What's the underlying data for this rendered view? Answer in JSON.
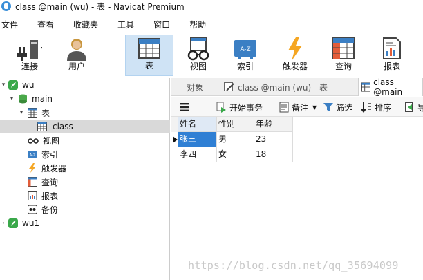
{
  "window": {
    "title": "class @main (wu) - 表 - Navicat Premium"
  },
  "menu": [
    "文件",
    "查看",
    "收藏夹",
    "工具",
    "窗口",
    "帮助"
  ],
  "toolbar": {
    "connect": "连接",
    "user": "用户",
    "table": "表",
    "view": "视图",
    "index": "索引",
    "trigger": "触发器",
    "query": "查询",
    "report": "报表"
  },
  "tree": {
    "conn1": "wu",
    "db": "main",
    "tables_group": "表",
    "table_class": "class",
    "views": "视图",
    "indexes": "索引",
    "triggers": "触发器",
    "queries": "查询",
    "reports": "报表",
    "backup": "备份",
    "conn2": "wu1"
  },
  "tabs": {
    "objects": "对象",
    "tab1": "class @main (wu) - 表",
    "tab2": "class @main"
  },
  "subtoolbar": {
    "begin_tx": "开始事务",
    "memo": "备注",
    "filter": "筛选",
    "sort": "排序",
    "import": "导"
  },
  "grid": {
    "columns": [
      "姓名",
      "性别",
      "年龄"
    ],
    "rows": [
      [
        "张三",
        "男",
        "23"
      ],
      [
        "李四",
        "女",
        "18"
      ]
    ]
  },
  "watermark": "https://blog.csdn.net/qq_35694099"
}
